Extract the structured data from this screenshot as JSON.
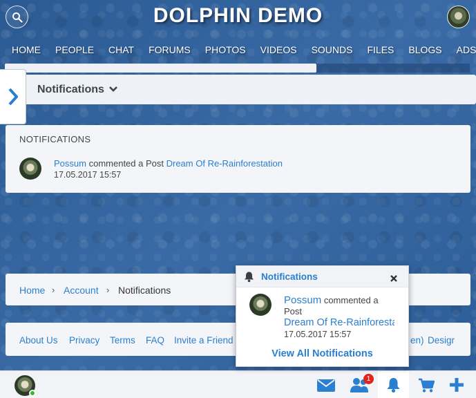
{
  "site": {
    "title": "DOLPHIN DEMO"
  },
  "nav": {
    "items": [
      {
        "label": "HOME"
      },
      {
        "label": "PEOPLE"
      },
      {
        "label": "CHAT"
      },
      {
        "label": "FORUMS"
      },
      {
        "label": "PHOTOS"
      },
      {
        "label": "VIDEOS"
      },
      {
        "label": "SOUNDS"
      },
      {
        "label": "FILES"
      },
      {
        "label": "BLOGS"
      },
      {
        "label": "ADS"
      }
    ]
  },
  "page": {
    "header_title": "Notifications",
    "progress_fraction": 0.67
  },
  "notifications_card": {
    "title": "NOTIFICATIONS",
    "item": {
      "user": "Possum",
      "action": "commented a Post",
      "target": "Dream Of Re-Rainforestation",
      "date": "17.05.2017 15:57"
    }
  },
  "breadcrumb": {
    "home": "Home",
    "sep": "›",
    "account": "Account",
    "current": "Notifications"
  },
  "footer": {
    "links": [
      "About Us",
      "Privacy",
      "Terms",
      "FAQ",
      "Invite a Friend"
    ],
    "partial_text": "en)",
    "partial_link": "Desigr"
  },
  "popup": {
    "title": "Notifications",
    "close_glyph": "✖",
    "user": "Possum",
    "action_line1": "commented a",
    "action_line2": "Post",
    "target": "Dream Of Re-Rainforestation",
    "date": "17.05.2017 15:57",
    "view_all": "View All Notifications"
  },
  "bottombar": {
    "friends_badge": "1",
    "icons": [
      "envelope-icon",
      "users-icon",
      "bell-icon",
      "cart-icon",
      "plus-icon"
    ]
  },
  "colors": {
    "link": "#2a7fd0",
    "badge": "#e0241b",
    "online": "#35b935",
    "background": "#2f5f99"
  }
}
